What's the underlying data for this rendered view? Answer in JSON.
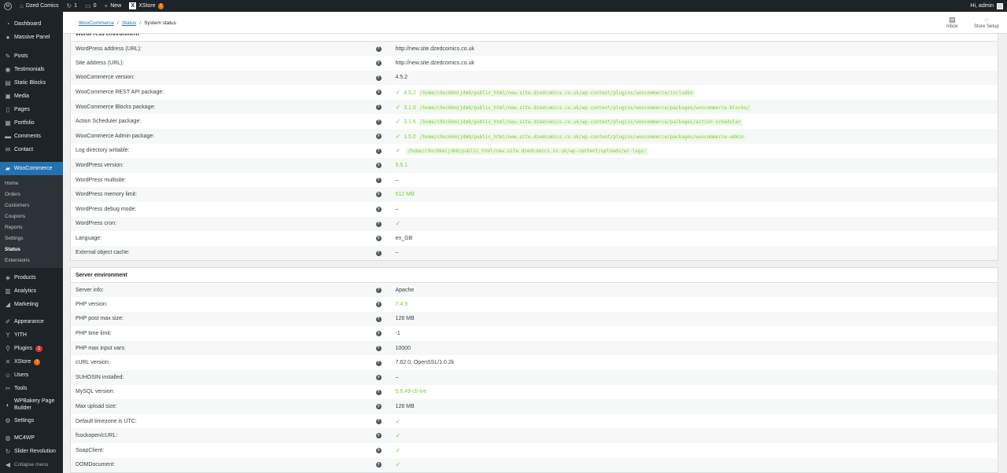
{
  "adminbar": {
    "site_name": "Dzed Comics",
    "updates_count": "1",
    "comments_count": "0",
    "new_label": "New",
    "xstore_label": "XStore",
    "xstore_badge": "!",
    "greeting": "Hi, admin"
  },
  "sidebar": {
    "items": [
      {
        "label": "Dashboard",
        "icon": "dashboard-icon"
      },
      {
        "label": "Massive Panel",
        "icon": "location-icon"
      },
      {
        "label": "Posts",
        "icon": "pin-icon"
      },
      {
        "label": "Testimonials",
        "icon": "comments-icon"
      },
      {
        "label": "Static Blocks",
        "icon": "blocks-icon"
      },
      {
        "label": "Media",
        "icon": "media-icon"
      },
      {
        "label": "Pages",
        "icon": "page-icon"
      },
      {
        "label": "Portfolio",
        "icon": "portfolio-icon"
      },
      {
        "label": "Comments",
        "icon": "comment-icon"
      },
      {
        "label": "Contact",
        "icon": "mail-icon"
      },
      {
        "label": "WooCommerce",
        "icon": "woo-icon"
      }
    ],
    "woo_sub": [
      "Home",
      "Orders",
      "Customers",
      "Coupons",
      "Reports",
      "Settings",
      "Status",
      "Extensions"
    ],
    "items2": [
      {
        "label": "Products",
        "icon": "products-icon"
      },
      {
        "label": "Analytics",
        "icon": "analytics-icon"
      },
      {
        "label": "Marketing",
        "icon": "megaphone-icon"
      },
      {
        "label": "Appearance",
        "icon": "brush-icon"
      },
      {
        "label": "YITH",
        "icon": "yith-icon"
      },
      {
        "label": "Plugins",
        "icon": "plugin-icon",
        "badge": "1"
      },
      {
        "label": "XStore",
        "icon": "xstore-icon",
        "badge": "!"
      },
      {
        "label": "Users",
        "icon": "users-icon"
      },
      {
        "label": "Tools",
        "icon": "tools-icon"
      },
      {
        "label": "WPBakery Page Builder",
        "icon": "wpbakery-icon"
      },
      {
        "label": "Settings",
        "icon": "settings-icon"
      },
      {
        "label": "MC4WP",
        "icon": "mc4wp-icon"
      },
      {
        "label": "Slider Revolution",
        "icon": "slider-icon"
      },
      {
        "label": "Collapse menu",
        "icon": "collapse-icon"
      }
    ]
  },
  "header": {
    "breadcrumb": [
      "WooCommerce",
      "Status",
      "System status"
    ],
    "inbox_label": "Inbox",
    "setup_label": "Store Setup"
  },
  "wp_section": {
    "title": "WordPress environment",
    "rows": [
      {
        "label": "WordPress address (URL):",
        "value": "http://new.site.dzedcomics.co.uk"
      },
      {
        "label": "Site address (URL):",
        "value": "http://new.site.dzedcomics.co.uk"
      },
      {
        "label": "WooCommerce version:",
        "value": "4.5.2"
      },
      {
        "label": "WooCommerce REST API package:",
        "version": "4.5.2",
        "path": "/home/c9oc6kmijdm8/public_html/new.site.dzedcomics.co.uk/wp-content/plugins/woocommerce/includes"
      },
      {
        "label": "WooCommerce Blocks package:",
        "version": "3.1.0",
        "path": "/home/c9oc6kmijdm8/public_html/new.site.dzedcomics.co.uk/wp-content/plugins/woocommerce/packages/woocommerce-blocks/"
      },
      {
        "label": "Action Scheduler package:",
        "version": "3.1.6",
        "path": "/home/c9oc6kmijdm8/public_html/new.site.dzedcomics.co.uk/wp-content/plugins/woocommerce/packages/action-scheduler"
      },
      {
        "label": "WooCommerce Admin package:",
        "version": "1.5.0",
        "path": "/home/c9oc6kmijdm8/public_html/new.site.dzedcomics.co.uk/wp-content/plugins/woocommerce/packages/woocommerce-admin"
      },
      {
        "label": "Log directory writable:",
        "path": "/home/c9oc6kmijdm8/public_html/new.site.dzedcomics.co.uk/wp-content/uploads/wc-logs/"
      },
      {
        "label": "WordPress version:",
        "value": "5.5.1"
      },
      {
        "label": "WordPress multisite:",
        "value": "–"
      },
      {
        "label": "WordPress memory limit:",
        "value": "512 MB"
      },
      {
        "label": "WordPress debug mode:",
        "value": "–"
      },
      {
        "label": "WordPress cron:",
        "value": "✓"
      },
      {
        "label": "Language:",
        "value": "en_GB"
      },
      {
        "label": "External object cache:",
        "value": "–"
      }
    ]
  },
  "server_section": {
    "title": "Server environment",
    "rows": [
      {
        "label": "Server info:",
        "value": "Apache"
      },
      {
        "label": "PHP version:",
        "value": "7.4.9"
      },
      {
        "label": "PHP post max size:",
        "value": "128 MB"
      },
      {
        "label": "PHP time limit:",
        "value": "-1"
      },
      {
        "label": "PHP max input vars:",
        "value": "10000"
      },
      {
        "label": "cURL version:",
        "value": "7.62.0, OpenSSL/1.0.2k"
      },
      {
        "label": "SUHOSIN installed:",
        "value": "–"
      },
      {
        "label": "MySQL version:",
        "value": "5.6.49-cll-lve"
      },
      {
        "label": "Max upload size:",
        "value": "128 MB"
      },
      {
        "label": "Default timezone is UTC:",
        "value": "✓"
      },
      {
        "label": "fsockopen/cURL:",
        "value": "✓"
      },
      {
        "label": "SoapClient:",
        "value": "✓"
      },
      {
        "label": "DOMDocument:",
        "value": "✓"
      }
    ]
  },
  "colors": {
    "accent": "#2271b1",
    "ok": "#7ad03a",
    "bar": "#1d2327"
  }
}
